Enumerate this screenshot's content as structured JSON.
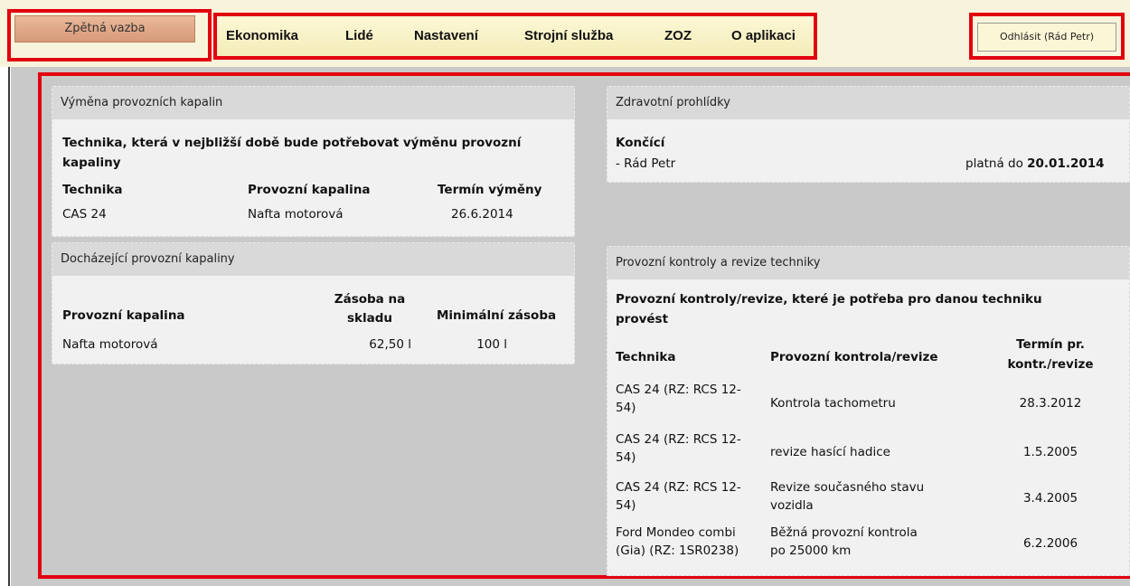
{
  "topbar": {
    "feedback_label": "Zpětná vazba",
    "nav": [
      "Ekonomika",
      "Lidé",
      "Nastavení",
      "Strojní služba",
      "ZOZ",
      "O aplikaci"
    ],
    "logout_label": "Odhlásit (Rád Petr)"
  },
  "fluid_change": {
    "header": "Výměna provozních kapalin",
    "intro_line1": "Technika, která v nejbližší době bude potřebovat výměnu provozní",
    "intro_line2": "kapaliny",
    "columns": [
      "Technika",
      "Provozní kapalina",
      "Termín výměny"
    ],
    "rows": [
      {
        "technika": "CAS 24",
        "kapalina": "Nafta motorová",
        "termin": "26.6.2014"
      }
    ]
  },
  "fluid_low": {
    "header": "Docházející provozní kapaliny",
    "col_fluid": "Provozní kapalina",
    "col_stock_l1": "Zásoba na",
    "col_stock_l2": "skladu",
    "col_min": "Minimální zásoba",
    "rows": [
      {
        "kapalina": "Nafta motorová",
        "zasoba": "62,50 l",
        "minimum": "100 l"
      }
    ]
  },
  "health": {
    "header": "Zdravotní prohlídky",
    "ending_label": "Končící",
    "person": "- Rád Petr",
    "valid_prefix": "platná do",
    "valid_date": "20.01.2014"
  },
  "inspections": {
    "header": "Provozní kontroly a revize techniky",
    "intro_line1": "Provozní kontroly/revize, které je potřeba pro danou techniku",
    "intro_line2": "provést",
    "col_tech": "Technika",
    "col_check": "Provozní kontrola/revize",
    "col_date_l1": "Termín pr.",
    "col_date_l2": "kontr./revize",
    "rows": [
      {
        "tech1": "CAS 24 (RZ: RCS 12-",
        "tech2": "54)",
        "check1": "Kontrola tachometru",
        "check2": "",
        "date": "28.3.2012"
      },
      {
        "tech1": "CAS 24 (RZ: RCS 12-",
        "tech2": "54)",
        "check1": "revize hasící hadice",
        "check2": "",
        "date": "1.5.2005"
      },
      {
        "tech1": "CAS 24 (RZ: RCS 12-",
        "tech2": "54)",
        "check1": "Revize současného stavu",
        "check2": "vozidla",
        "date": "3.4.2005"
      },
      {
        "tech1": "Ford Mondeo combi",
        "tech2": "(Gia) (RZ: 1SR0238)",
        "check1": "Běžná provozní kontrola",
        "check2": "po 25000 km",
        "date": "6.2.2006"
      }
    ]
  }
}
